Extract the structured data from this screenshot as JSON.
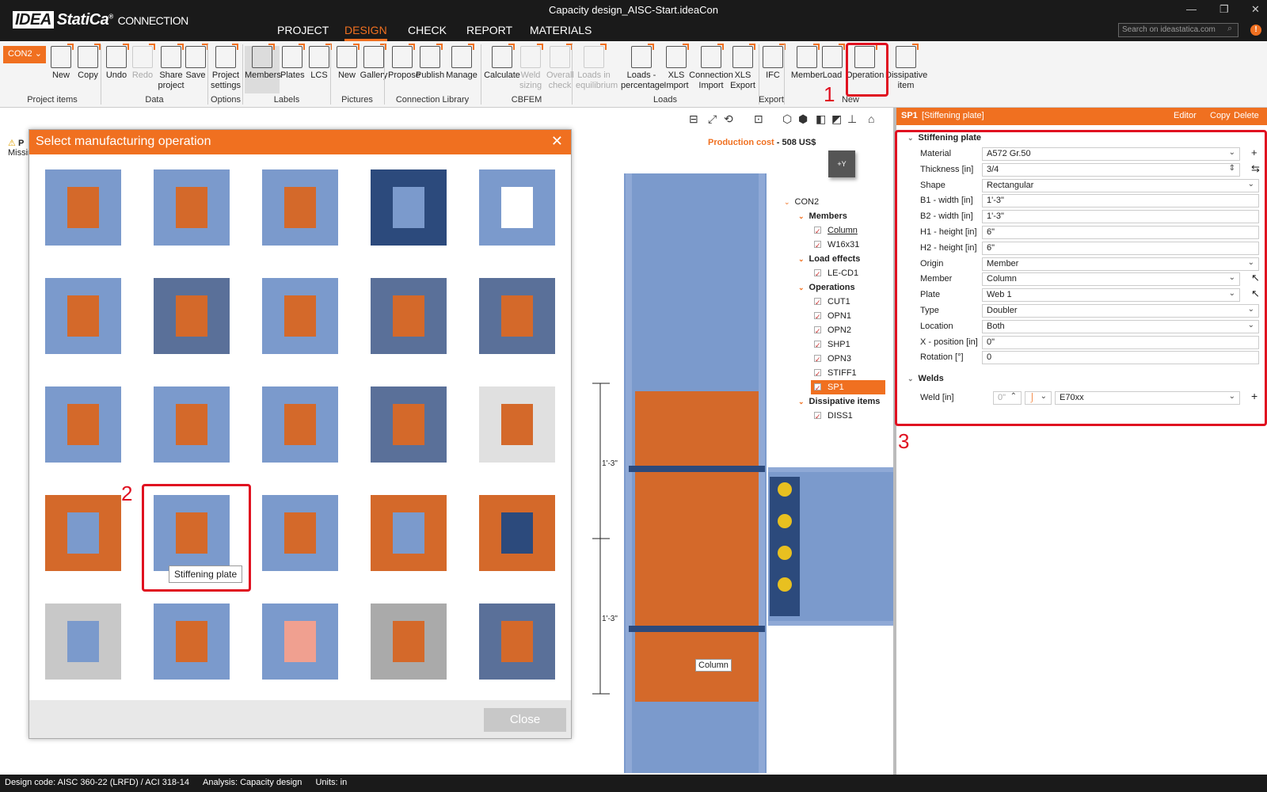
{
  "app": {
    "logo_idea": "IDEA",
    "logo_statica": "StatiCa",
    "logo_reg": "®",
    "logo_product": "CONNECTION",
    "window_title": "Capacity design_AISC-Start.ideaCon",
    "minimize": "—",
    "restore": "❐",
    "close": "✕"
  },
  "menu": [
    "PROJECT",
    "DESIGN",
    "CHECK",
    "REPORT",
    "MATERIALS"
  ],
  "search": {
    "placeholder": "Search on ideastatica.com"
  },
  "help": "!",
  "ribbon": {
    "connection_select": "CON2",
    "buttons": [
      {
        "label": "New",
        "state": "normal"
      },
      {
        "label": "Copy",
        "state": "normal"
      },
      {
        "label": "Undo",
        "state": "normal"
      },
      {
        "label": "Redo",
        "state": "disabled"
      },
      {
        "label": "Share project",
        "state": "normal"
      },
      {
        "label": "Save",
        "state": "normal"
      },
      {
        "label": "Project settings",
        "state": "normal"
      },
      {
        "label": "Members",
        "state": "selected"
      },
      {
        "label": "Plates",
        "state": "normal"
      },
      {
        "label": "LCS",
        "state": "normal"
      },
      {
        "label": "New",
        "state": "normal"
      },
      {
        "label": "Gallery",
        "state": "normal"
      },
      {
        "label": "Propose",
        "state": "normal"
      },
      {
        "label": "Publish",
        "state": "normal"
      },
      {
        "label": "Manage",
        "state": "normal"
      },
      {
        "label": "Calculate",
        "state": "normal"
      },
      {
        "label": "Weld sizing",
        "state": "disabled"
      },
      {
        "label": "Overall check",
        "state": "disabled"
      },
      {
        "label": "Loads in equilibrium",
        "state": "disabled"
      },
      {
        "label": "Loads - percentage",
        "state": "normal"
      },
      {
        "label": "XLS Import",
        "state": "normal"
      },
      {
        "label": "Connection Import",
        "state": "normal"
      },
      {
        "label": "XLS Export",
        "state": "normal"
      },
      {
        "label": "IFC",
        "state": "normal"
      },
      {
        "label": "Member",
        "state": "normal"
      },
      {
        "label": "Load",
        "state": "normal"
      },
      {
        "label": "Operation",
        "state": "normal"
      },
      {
        "label": "Dissipative item",
        "state": "normal"
      }
    ],
    "groups": [
      "Project items",
      "Data",
      "Options",
      "Labels",
      "Pictures",
      "Connection Library",
      "CBFEM",
      "Loads",
      "Export",
      "New"
    ]
  },
  "annotations": [
    "1",
    "2",
    "3"
  ],
  "warning": {
    "icon": "⚠",
    "title": "P",
    "text": "Missin"
  },
  "dialog": {
    "title": "Select manufacturing operation",
    "close_icon": "✕",
    "close_button": "Close",
    "tooltip": "Stiffening plate"
  },
  "viewport": {
    "production_cost_label": "Production cost",
    "production_cost_value": "- 508 US$",
    "orient_cube": "+Y",
    "dim1": "1'-3\"",
    "dim2": "1'-3\"",
    "member_label": "Column",
    "view_tools": [
      "⊟",
      "⤢",
      "⟲",
      "⊡",
      "⬡",
      "⬢",
      "◧",
      "◩",
      "⊥",
      "⌂"
    ]
  },
  "tree": {
    "root": "CON2",
    "members_header": "Members",
    "members": [
      "Column",
      "W16x31"
    ],
    "loads_header": "Load effects",
    "loads": [
      "LE-CD1"
    ],
    "ops_header": "Operations",
    "operations": [
      "CUT1",
      "OPN1",
      "OPN2",
      "SHP1",
      "OPN3",
      "STIFF1",
      "SP1"
    ],
    "selected": "SP1",
    "diss_header": "Dissipative items",
    "dissipative": [
      "DISS1"
    ]
  },
  "props": {
    "header_id": "SP1",
    "header_type": "[Stiffening plate]",
    "actions": [
      "Editor",
      "Copy",
      "Delete"
    ],
    "section_title": "Stiffening plate",
    "rows": [
      {
        "label": "Material",
        "value": "A572 Gr.50",
        "ctrl": "dropdown",
        "side": "+"
      },
      {
        "label": "Thickness [in]",
        "value": "3/4",
        "ctrl": "spin",
        "side": "⇆"
      },
      {
        "label": "Shape",
        "value": "Rectangular",
        "ctrl": "dropdown",
        "side": ""
      },
      {
        "label": "B1 - width [in]",
        "value": "1'-3\"",
        "ctrl": "text",
        "side": ""
      },
      {
        "label": "B2 - width [in]",
        "value": "1'-3\"",
        "ctrl": "text",
        "side": ""
      },
      {
        "label": "H1 - height [in]",
        "value": "6\"",
        "ctrl": "text",
        "side": ""
      },
      {
        "label": "H2 - height [in]",
        "value": "6\"",
        "ctrl": "text",
        "side": ""
      },
      {
        "label": "Origin",
        "value": "Member",
        "ctrl": "dropdown",
        "side": ""
      },
      {
        "label": "Member",
        "value": "Column",
        "ctrl": "dropdown",
        "side": "↖"
      },
      {
        "label": "Plate",
        "value": "Web 1",
        "ctrl": "dropdown",
        "side": "↖"
      },
      {
        "label": "Type",
        "value": "Doubler",
        "ctrl": "dropdown",
        "side": ""
      },
      {
        "label": "Location",
        "value": "Both",
        "ctrl": "dropdown",
        "side": ""
      },
      {
        "label": "X - position [in]",
        "value": "0\"",
        "ctrl": "text",
        "side": ""
      },
      {
        "label": "Rotation [°]",
        "value": "0",
        "ctrl": "text",
        "side": ""
      }
    ],
    "welds_title": "Welds",
    "weld_label": "Weld [in]",
    "weld_size": "0\"",
    "weld_material": "E70xx",
    "weld_add": "+"
  },
  "status": {
    "design_code": "Design code: AISC 360-22 (LRFD) / ACI 318-14",
    "analysis_label": "Analysis:",
    "analysis_value": "Capacity design",
    "units_label": "Units:",
    "units_value": "in"
  },
  "colors": {
    "accent": "#f07020",
    "steel": "#7b9acc",
    "plate": "#d4692a",
    "highlight": "#e01020"
  }
}
